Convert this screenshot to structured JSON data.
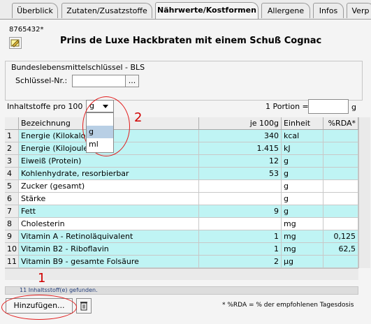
{
  "tabs": [
    "Überblick",
    "Zutaten/Zusatzstoffe",
    "Nährwerte/Kostformen",
    "Allergene",
    "Infos",
    "Verp"
  ],
  "header": {
    "article_number": "8765432*",
    "product_title": "Prins de Luxe Hackbraten mit einem Schuß Cognac"
  },
  "bls": {
    "group_title": "Bundeslebensmittelschlüssel - BLS",
    "key_label": "Schlüssel-Nr.:",
    "key_value": "",
    "browse_label": "..."
  },
  "content": {
    "per_label": "Inhaltstoffe pro 100",
    "unit_selected": "g",
    "unit_options": [
      "",
      "g",
      "ml"
    ],
    "portion_label": "1 Portion =",
    "portion_value": "",
    "portion_unit": "g"
  },
  "table": {
    "headers": [
      "Bezeichnung",
      "je 100g",
      "Einheit",
      "%RDA*"
    ],
    "rows": [
      {
        "index": "1",
        "name": "Energie (Kilokalorien)",
        "value": "340",
        "unit": "kcal",
        "rda": "",
        "highlighted": true
      },
      {
        "index": "2",
        "name": "Energie (Kilojoule)",
        "value": "1.415",
        "unit": "kJ",
        "rda": "",
        "highlighted": true
      },
      {
        "index": "3",
        "name": "Eiweiß (Protein)",
        "value": "12",
        "unit": "g",
        "rda": "",
        "highlighted": true
      },
      {
        "index": "4",
        "name": "Kohlenhydrate, resorbierbar",
        "value": "53",
        "unit": "g",
        "rda": "",
        "highlighted": true
      },
      {
        "index": "5",
        "name": "Zucker (gesamt)",
        "value": "",
        "unit": "g",
        "rda": "",
        "highlighted": false
      },
      {
        "index": "6",
        "name": "Stärke",
        "value": "",
        "unit": "g",
        "rda": "",
        "highlighted": false
      },
      {
        "index": "7",
        "name": "Fett",
        "value": "9",
        "unit": "g",
        "rda": "",
        "highlighted": true
      },
      {
        "index": "8",
        "name": "Cholesterin",
        "value": "",
        "unit": "mg",
        "rda": "",
        "highlighted": false
      },
      {
        "index": "9",
        "name": "Vitamin A - Retinoläquivalent",
        "value": "1",
        "unit": "mg",
        "rda": "0,125",
        "highlighted": true
      },
      {
        "index": "10",
        "name": "Vitamin B2 - Riboflavin",
        "value": "1",
        "unit": "mg",
        "rda": "62,5",
        "highlighted": true
      },
      {
        "index": "11",
        "name": "Vitamin B9 - gesamte Folsäure",
        "value": "2",
        "unit": "µg",
        "rda": "",
        "highlighted": true
      }
    ]
  },
  "status_text": "11 Inhaltsstoff(e) gefunden.",
  "footer": {
    "add_label": "Hinzufügen...",
    "rda_note": "* %RDA = % der empfohlenen Tagesdosis"
  },
  "annotations": {
    "one": "1",
    "two": "2"
  },
  "colors": {
    "highlight_row": "#bff4f4",
    "annotation_red": "#e21c1c",
    "selected_option": "#b8cfe5"
  }
}
